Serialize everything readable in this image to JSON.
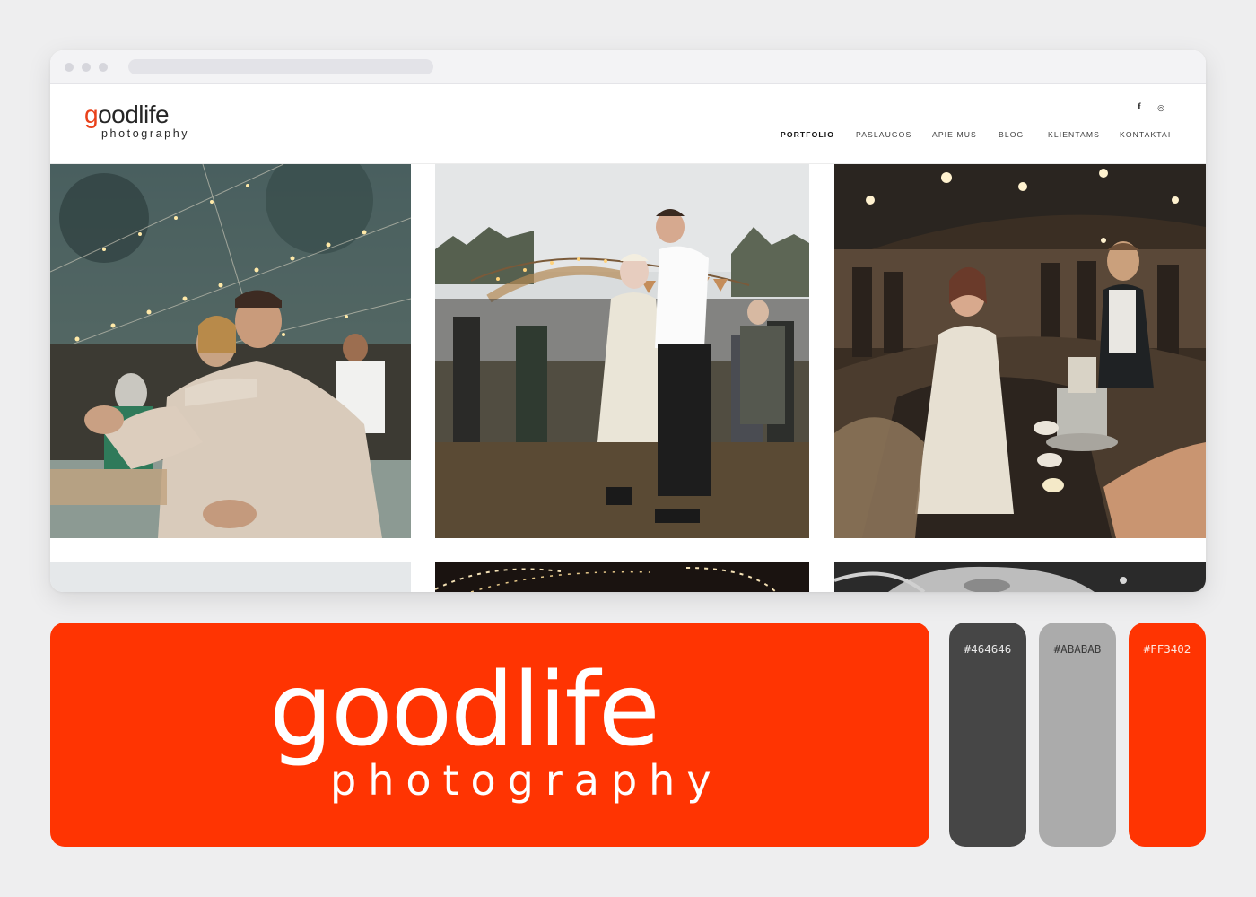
{
  "site": {
    "logo_word_accent": "g",
    "logo_word_rest": "oodlife",
    "logo_sub": "photography",
    "social": [
      {
        "name": "facebook-icon",
        "glyph": "f"
      },
      {
        "name": "instagram-icon",
        "glyph": "◎"
      }
    ],
    "nav": [
      {
        "label": "PORTFOLIO",
        "active": true
      },
      {
        "label": "PASLAUGOS",
        "active": false
      },
      {
        "label": "APIE MUS",
        "active": false
      },
      {
        "label": "BLOG",
        "active": false
      },
      {
        "label": "KLIENTAMS",
        "active": false
      },
      {
        "label": "KONTAKTAI",
        "active": false
      }
    ]
  },
  "brand_card": {
    "word": "goodlife",
    "sub": "photography"
  },
  "palette": [
    {
      "hex": "#464646",
      "label": "#464646",
      "text_color": "#e8e8e8"
    },
    {
      "hex": "#ABABAB",
      "label": "#ABABAB",
      "text_color": "#3a3a3a"
    },
    {
      "hex": "#FF3402",
      "label": "#FF3402",
      "text_color": "#ffe9e2"
    }
  ],
  "colors": {
    "accent": "#ff3402",
    "logo_g": "#e9411a"
  }
}
